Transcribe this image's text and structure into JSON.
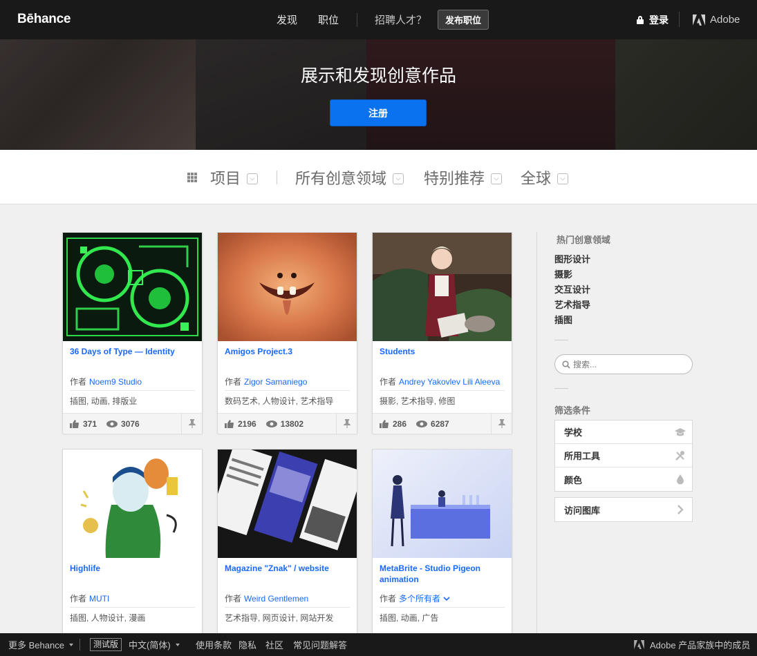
{
  "nav": {
    "logo": "Bēhance",
    "discover": "发现",
    "jobs": "职位",
    "hire": "招聘人才？",
    "post_job": "发布职位",
    "login": "登录",
    "adobe": "Adobe"
  },
  "hero": {
    "title": "展示和发现创意作品",
    "signup": "注册"
  },
  "filters": {
    "content": "项目",
    "fields": "所有创意领域",
    "sort": "特别推荐",
    "location": "全球"
  },
  "projects": [
    {
      "title": "36 Days of Type — Identity",
      "owner_label": "作者",
      "owner": "Noem9 Studio",
      "fields": "插图, 动画, 排版业",
      "likes": "371",
      "views": "3076"
    },
    {
      "title": "Amigos Project.3",
      "owner_label": "作者",
      "owner": "Zigor Samaniego",
      "fields": "数码艺术, 人物设计, 艺术指导",
      "likes": "2196",
      "views": "13802"
    },
    {
      "title": "Students",
      "owner_label": "作者",
      "owner": "Andrey Yakovlev Lili Aleeva",
      "fields": "摄影, 艺术指导, 修图",
      "likes": "286",
      "views": "6287"
    },
    {
      "title": "Highlife",
      "owner_label": "作者",
      "owner": "MUTI",
      "fields": "插图, 人物设计, 漫画"
    },
    {
      "title": "Magazine \"Znak\" / website",
      "owner_label": "作者",
      "owner": "Weird Gentlemen",
      "fields": "艺术指导, 网页设计, 网站开发"
    },
    {
      "title": "MetaBrite - Studio Pigeon animation",
      "owner_label": "作者",
      "owner": "多个所有者",
      "fields": "插图, 动画, 广告"
    }
  ],
  "sidebar": {
    "popular_heading": "热门创意领域",
    "popular": [
      "图形设计",
      "摄影",
      "交互设计",
      "艺术指导",
      "插图"
    ],
    "search_placeholder": "搜索...",
    "filter_heading": "筛选条件",
    "filters": [
      "学校",
      "所用工具",
      "颜色"
    ],
    "gallery": "访问图库"
  },
  "footer": {
    "more": "更多 Behance",
    "beta": "测试版",
    "language": "中文(简体)",
    "terms": "使用条款",
    "privacy": "隐私",
    "community": "社区",
    "faq": "常见问题解答",
    "member": "Adobe 产品家族中的成员"
  },
  "colors": {
    "accent": "#1769ff",
    "signup": "#0b72ef",
    "nav_bg": "#191919"
  }
}
